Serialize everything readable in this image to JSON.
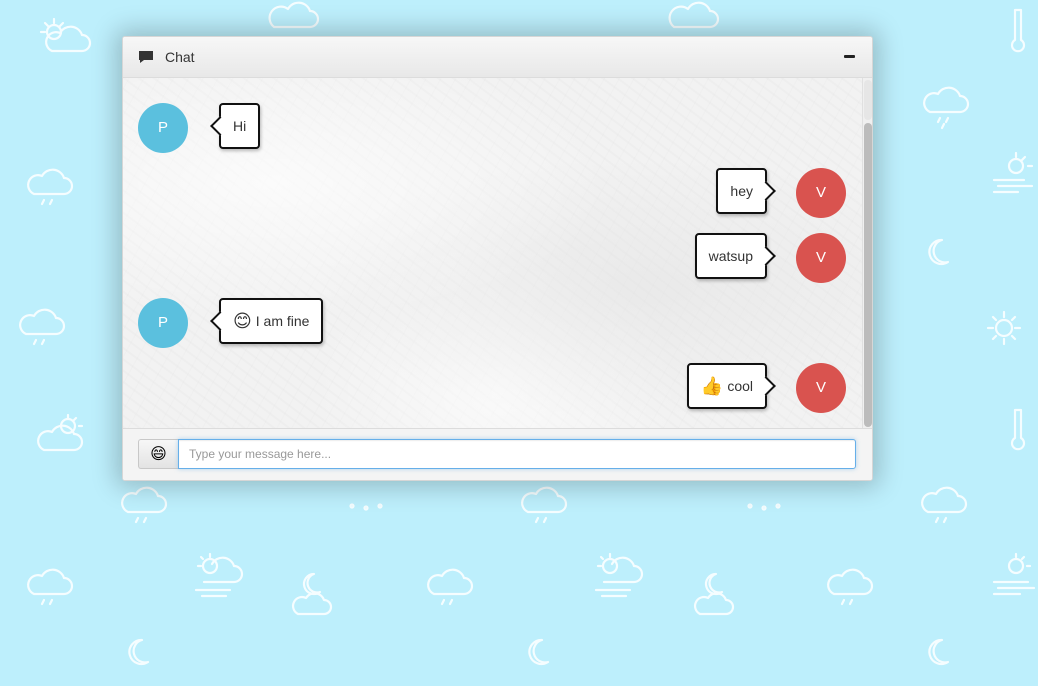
{
  "header": {
    "title": "Chat",
    "icon": "chat-bubble-icon",
    "minimize_icon": "minimize-icon"
  },
  "messages": [
    {
      "side": "left",
      "avatar": "P",
      "text": "Hi",
      "emoji": ""
    },
    {
      "side": "right",
      "avatar": "V",
      "text": "hey",
      "emoji": ""
    },
    {
      "side": "right",
      "avatar": "V",
      "text": "watsup",
      "emoji": ""
    },
    {
      "side": "left",
      "avatar": "P",
      "text": "I am fine",
      "emoji": "😊"
    },
    {
      "side": "right",
      "avatar": "V",
      "text": "cool",
      "emoji": "👍"
    }
  ],
  "footer": {
    "emoji_button_glyph": "😄",
    "input_placeholder": "Type your message here...",
    "input_value": ""
  },
  "colors": {
    "background": "#bdeffc",
    "avatar_p": "#5bc0de",
    "avatar_v": "#d9534f"
  }
}
